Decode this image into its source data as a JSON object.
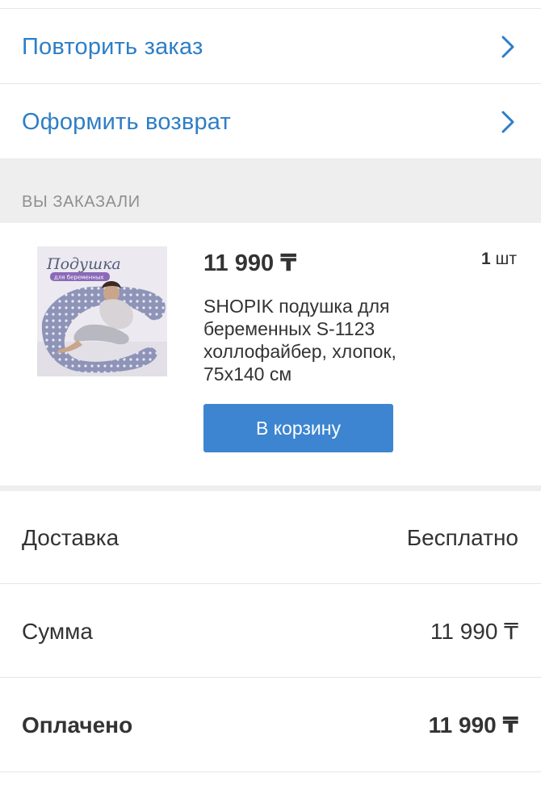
{
  "actions": {
    "repeat_order": "Повторить заказ",
    "make_return": "Оформить возврат"
  },
  "ordered_section": {
    "title": "ВЫ ЗАКАЗАЛИ"
  },
  "product": {
    "price": "11 990 ₸",
    "qty_number": "1",
    "qty_unit": "шт",
    "name": "SHOPIK подушка для беременных S-1123 холлофайбер, хлопок, 75х140 см",
    "add_to_cart": "В корзину",
    "image": {
      "title_script": "Подушка",
      "subtitle": "для беременных"
    }
  },
  "summary": {
    "delivery_label": "Доставка",
    "delivery_value": "Бесплатно",
    "sum_label": "Сумма",
    "sum_value": "11 990 ₸",
    "paid_label": "Оплачено",
    "paid_value": "11 990 ₸"
  },
  "colors": {
    "link": "#2e7ec6",
    "button": "#3d85d1",
    "section_bg": "#eeeeee",
    "muted_text": "#8f8f8f"
  },
  "icons": {
    "row_chevron": "chevron-right-icon"
  }
}
